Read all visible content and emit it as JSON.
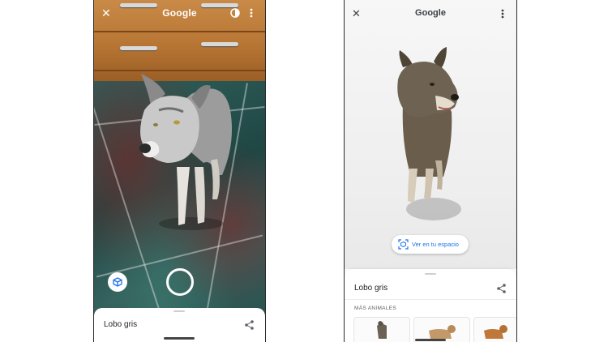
{
  "left_screen": {
    "app_title": "Google",
    "icons": {
      "close": "close-icon",
      "contrast": "contrast-icon",
      "menu": "more-vert-icon",
      "cube": "cube-icon",
      "shutter": "shutter-button",
      "share": "share-icon"
    },
    "sheet_title": "Lobo gris"
  },
  "right_screen": {
    "app_title": "Google",
    "view_in_space_label": "Ver en tu espacio",
    "sheet_title": "Lobo gris",
    "more_animals_label": "MÁS ANIMALES",
    "cards": [
      "wolf-thumbnail",
      "dog-thumbnail",
      "dog-thumbnail-2"
    ]
  },
  "colors": {
    "accent": "#1a73e8",
    "wood": "#b87634",
    "floor": "#2f5e5a"
  }
}
